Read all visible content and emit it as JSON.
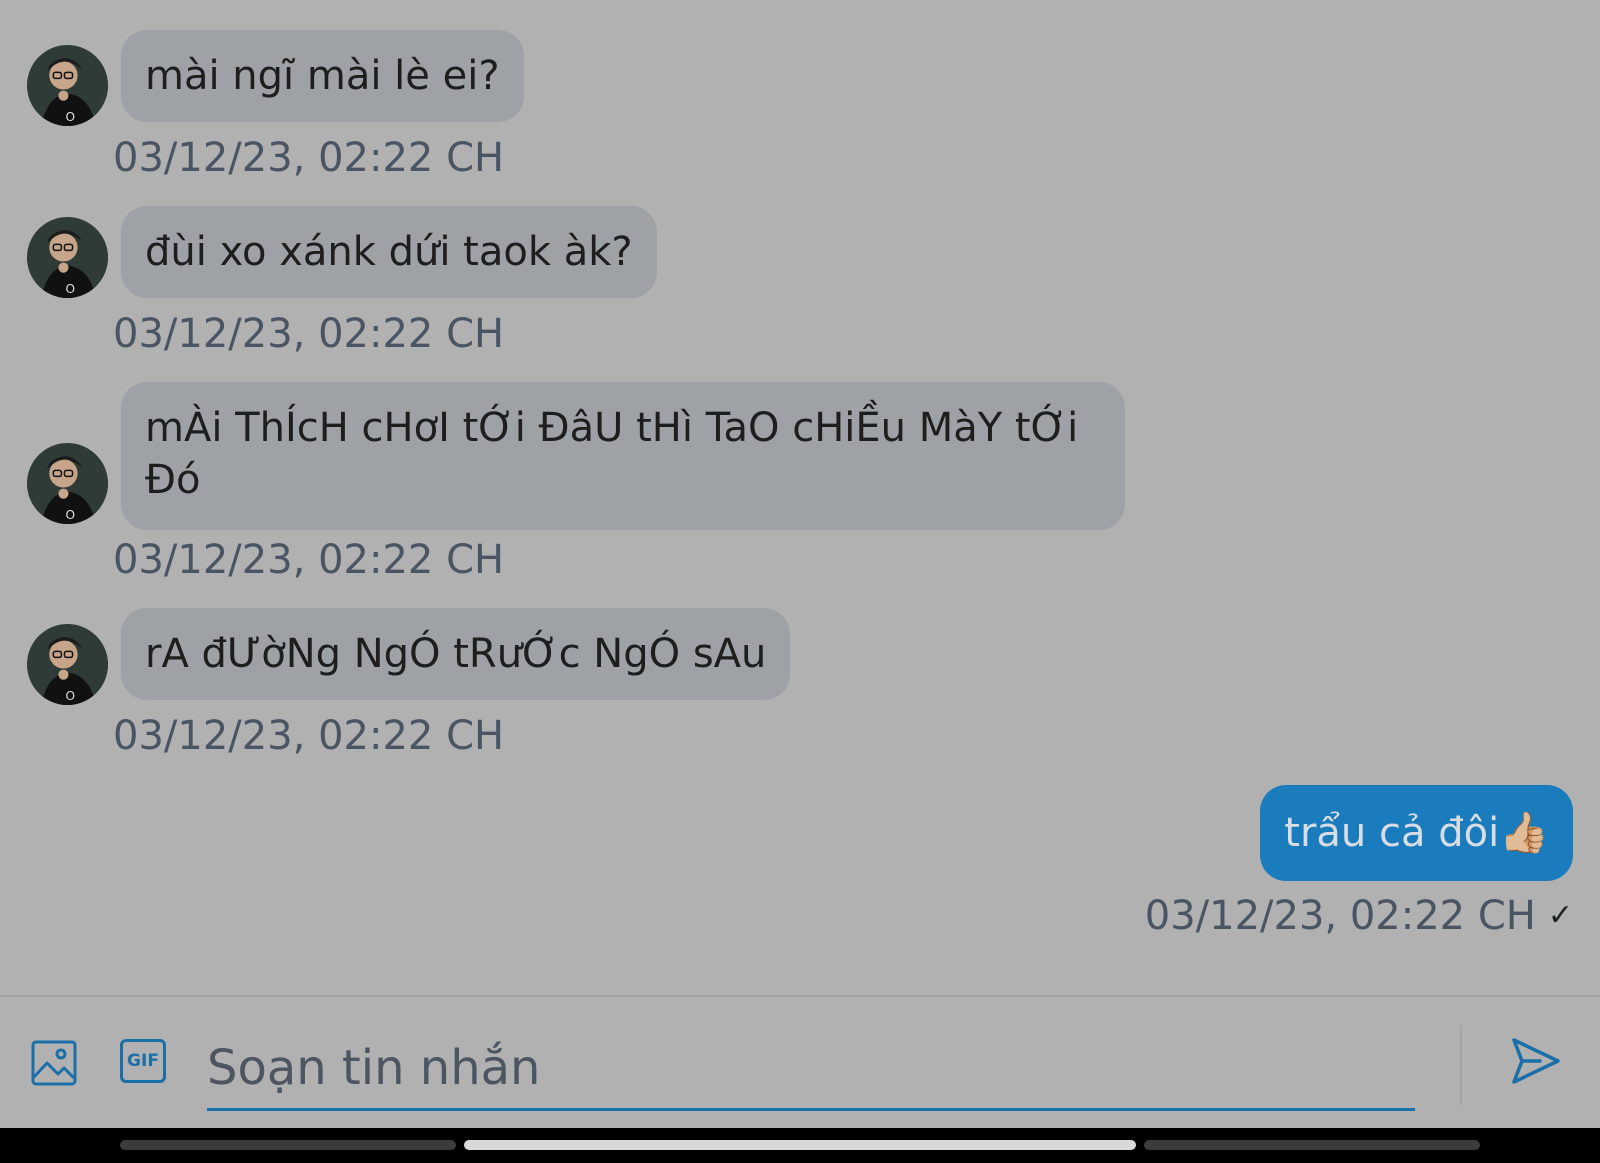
{
  "messages_in": [
    {
      "text": "mài ngĩ mài lè ei?",
      "time": "03/12/23, 02:22 CH"
    },
    {
      "text": "đùi xo xánk dứi taok àk?",
      "time": "03/12/23, 02:22 CH"
    },
    {
      "text": "mÀi ThÍcH cHơI tỚi ĐâU tHì TaO cHiỀu MàY tỚi\nĐó",
      "time": "03/12/23, 02:22 CH"
    },
    {
      "text": "rA đƯờNg NgÓ tRưỚc NgÓ sAu",
      "time": "03/12/23, 02:22 CH"
    }
  ],
  "message_out": {
    "text": "trẩu cả đôi👍🏼",
    "time": "03/12/23, 02:22 CH",
    "status_icon": "check-icon",
    "status_glyph": "✓"
  },
  "composer": {
    "placeholder": "Soạn tin nhắn",
    "gif_label": "GIF",
    "image_icon": "image-icon",
    "send_icon": "send-icon"
  },
  "colors": {
    "background": "#b1b1b1",
    "incoming_bubble": "#9ea2a6",
    "outgoing_bubble": "#1a7bbd",
    "accent": "#1a6fa8"
  }
}
